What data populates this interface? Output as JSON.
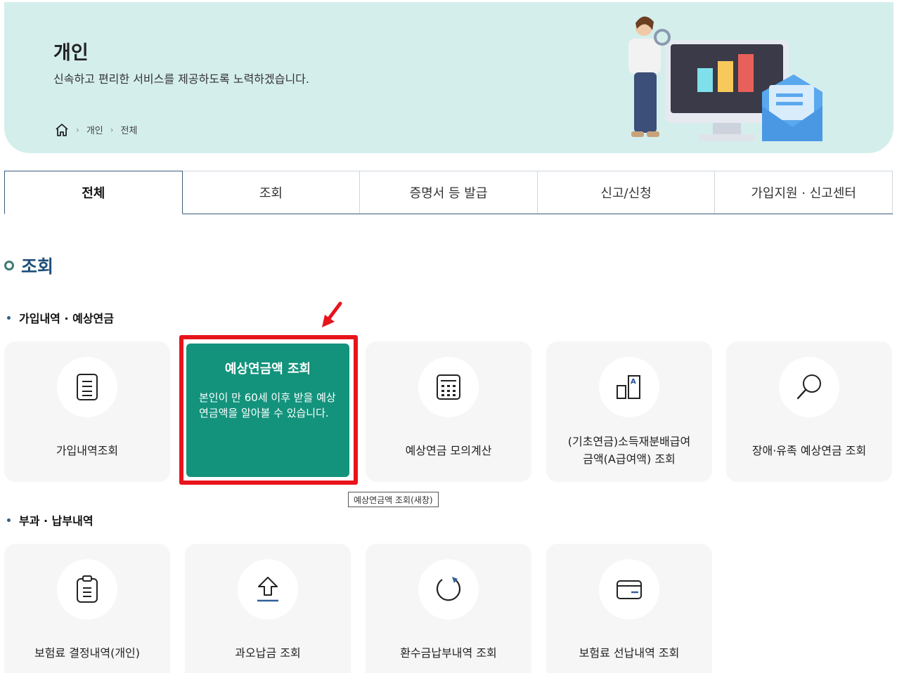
{
  "banner": {
    "title": "개인",
    "subtitle": "신속하고 편리한 서비스를 제공하도록 노력하겠습니다.",
    "breadcrumb": [
      "개인",
      "전체"
    ]
  },
  "tabs": [
    {
      "label": "전체",
      "active": true
    },
    {
      "label": "조회",
      "active": false
    },
    {
      "label": "증명서 등 발급",
      "active": false
    },
    {
      "label": "신고/신청",
      "active": false
    },
    {
      "label": "가입지원 · 신고센터",
      "active": false
    }
  ],
  "section": {
    "title": "조회"
  },
  "group1": {
    "title": "가입내역 · 예상연금",
    "cards": [
      {
        "label": "가입내역조회",
        "icon": "document-icon"
      },
      {
        "label": "예상연금액 조회",
        "desc": "본인이 만 60세 이후 받을 예상연금액을 알아볼 수 있습니다."
      },
      {
        "label": "예상연금 모의계산",
        "icon": "calculator-icon"
      },
      {
        "label_line1": "(기초연금)소득재분배급여",
        "label_line2": "금액(A급여액) 조회",
        "icon": "graph-a-icon"
      },
      {
        "label": "장애·유족 예상연금 조회",
        "icon": "magnifier-icon"
      }
    ]
  },
  "tooltip": "예상연금액 조회(새창)",
  "group2": {
    "title": "부과 · 납부내역",
    "cards": [
      {
        "label": "보험료 결정내역(개인)",
        "icon": "clipboard-icon"
      },
      {
        "label": "과오납금 조회",
        "icon": "upload-arrow-icon"
      },
      {
        "label": "환수금납부내역 조회",
        "icon": "refresh-icon"
      },
      {
        "label": "보험료 선납내역 조회",
        "icon": "wallet-icon"
      }
    ]
  },
  "colors": {
    "accent": "#13937c",
    "highlight": "#e8141b",
    "banner": "#d4eeec",
    "title": "#1f4f7a"
  }
}
